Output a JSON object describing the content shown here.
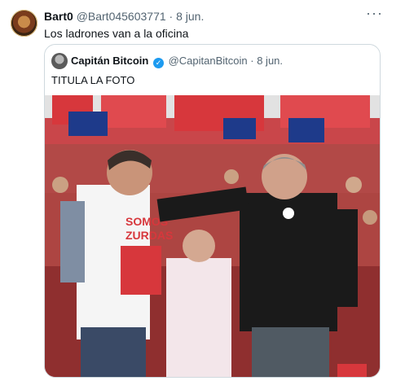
{
  "tweet": {
    "author_name": "Bart0",
    "author_handle": "@Bart045603771",
    "separator": "·",
    "time": "8 jun.",
    "text": "Los ladrones van a la oficina",
    "more_icon": "more-horizontal-icon"
  },
  "quoted": {
    "author_name": "Capitán Bitcoin",
    "author_handle": "@CapitanBitcoin",
    "separator": "·",
    "time": "8 jun.",
    "text": "TITULA LA FOTO",
    "verified_icon": "verified-badge-icon",
    "photo": {
      "shirt_text_line1": "SOMOS",
      "shirt_text_line2": "ZURDAS"
    }
  },
  "colors": {
    "verified": "#1d9bf0",
    "secondary_text": "#536471",
    "border": "#cfd9de",
    "banner_red": "#d7373c"
  }
}
